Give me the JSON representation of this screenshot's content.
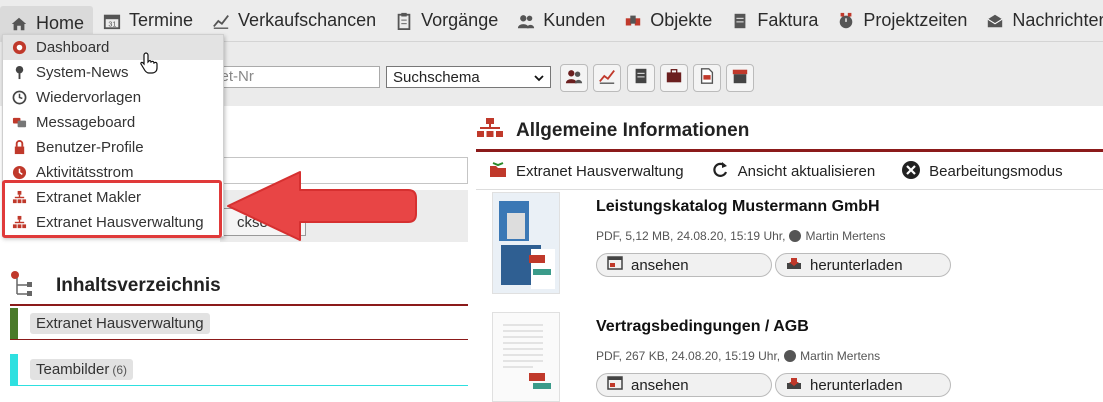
{
  "nav": {
    "items": [
      {
        "label": "Home",
        "icon": "home-icon"
      },
      {
        "label": "Termine",
        "icon": "calendar-icon"
      },
      {
        "label": "Verkaufschancen",
        "icon": "chart-icon"
      },
      {
        "label": "Vorgänge",
        "icon": "clipboard-icon"
      },
      {
        "label": "Kunden",
        "icon": "users-icon"
      },
      {
        "label": "Objekte",
        "icon": "objects-icon"
      },
      {
        "label": "Faktura",
        "icon": "invoice-icon"
      },
      {
        "label": "Projektzeiten",
        "icon": "project-time-icon"
      },
      {
        "label": "Nachrichten",
        "icon": "mail-icon"
      }
    ]
  },
  "toolbar": {
    "search_placeholder_visible": "ket-Nr",
    "schema_value": "Suchschema"
  },
  "dropdown": {
    "items": [
      {
        "label": "Dashboard",
        "icon": "dashboard-icon"
      },
      {
        "label": "System-News",
        "icon": "pin-icon"
      },
      {
        "label": "Wiedervorlagen",
        "icon": "clock-icon"
      },
      {
        "label": "Messageboard",
        "icon": "messageboard-icon"
      },
      {
        "label": "Benutzer-Profile",
        "icon": "lock-icon"
      },
      {
        "label": "Aktivitätsstrom",
        "icon": "activity-icon"
      },
      {
        "label": "Extranet Makler",
        "icon": "sitemap-icon"
      },
      {
        "label": "Extranet Hausverwaltung",
        "icon": "sitemap-icon"
      }
    ]
  },
  "left": {
    "button_label_visible": "ckse",
    "toc_title": "Inhaltsverzeichnis",
    "categories": [
      {
        "label": "Extranet Hausverwaltung",
        "count": "",
        "color": "#4a7a2a"
      },
      {
        "label": "Teambilder",
        "count": "(6)",
        "color": "#2ee0e0"
      }
    ]
  },
  "right": {
    "title": "Allgemeine Informationen",
    "actions": [
      {
        "label": "Extranet Hausverwaltung",
        "icon": "folder-icon"
      },
      {
        "label": "Ansicht aktualisieren",
        "icon": "refresh-icon"
      },
      {
        "label": "Bearbeitungsmodus",
        "icon": "close-circle-icon"
      }
    ],
    "documents": [
      {
        "title": "Leistungskatalog Mustermann GmbH",
        "meta": "PDF, 5,12 MB, 24.08.20, 15:19 Uhr,",
        "author": "Martin Mertens",
        "view": "ansehen",
        "download": "herunterladen"
      },
      {
        "title": "Vertragsbedingungen / AGB",
        "meta": "PDF, 267 KB, 24.08.20, 15:19 Uhr,",
        "author": "Martin Mertens",
        "view": "ansehen",
        "download": "herunterladen"
      }
    ]
  },
  "colors": {
    "accent_red": "#8b1a1a",
    "highlight": "#e03a3a"
  }
}
